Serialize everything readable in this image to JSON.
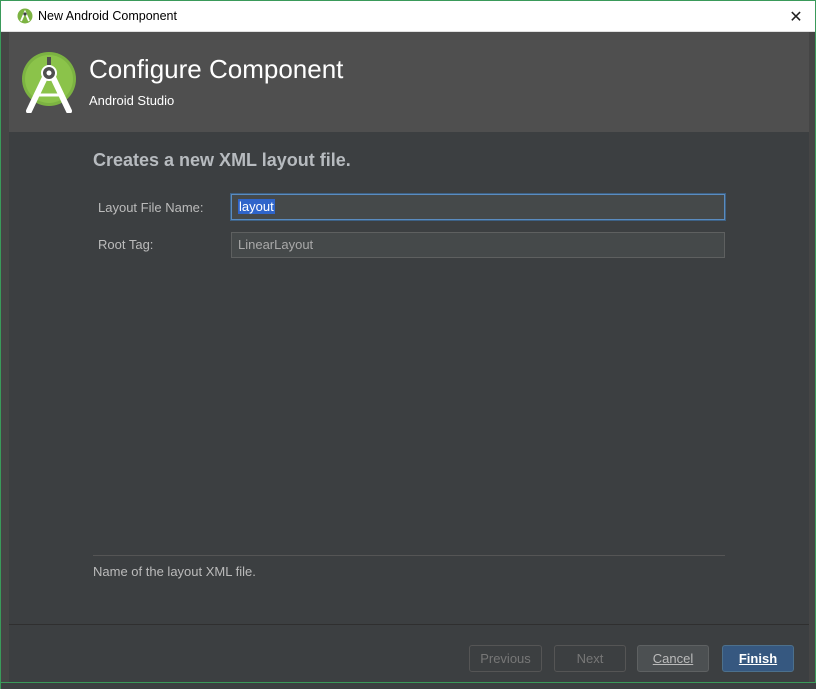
{
  "window": {
    "title": "New Android Component",
    "close_glyph": "✕"
  },
  "header": {
    "title": "Configure Component",
    "subtitle": "Android Studio",
    "logo_icon": "android-studio-logo-icon"
  },
  "content": {
    "section_title": "Creates a new XML layout file.",
    "fields": [
      {
        "label": "Layout File Name:",
        "value": "layout"
      },
      {
        "label": "Root Tag:",
        "value": "LinearLayout"
      }
    ],
    "hint": "Name of the layout XML file."
  },
  "footer": {
    "previous_label": "Previous",
    "next_label": "Next",
    "cancel_label": "Cancel",
    "finish_label": "Finish"
  },
  "colors": {
    "accent": "#3a9a5a",
    "primary_button": "#365880",
    "background": "#3c3f41",
    "header": "#4f4f4f"
  }
}
